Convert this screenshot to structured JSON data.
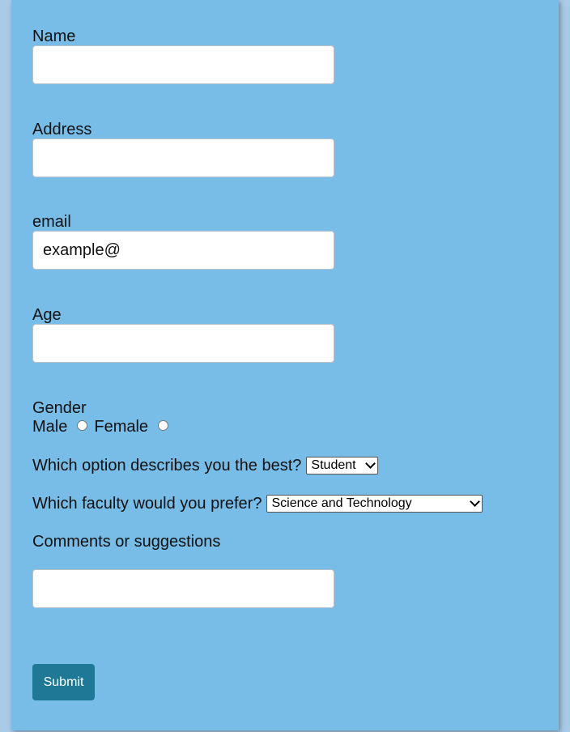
{
  "form": {
    "name": {
      "label": "Name",
      "value": ""
    },
    "address": {
      "label": "Address",
      "value": ""
    },
    "email": {
      "label": "email",
      "placeholder": "example@"
    },
    "age": {
      "label": "Age",
      "value": ""
    },
    "gender": {
      "label": "Gender",
      "options": [
        "Male",
        "Female"
      ]
    },
    "occupation": {
      "question": "Which option describes you the best?",
      "selected": "Student"
    },
    "faculty": {
      "question": "Which faculty would you prefer?",
      "selected": "Science and Technology"
    },
    "comments": {
      "label": "Comments or suggestions",
      "value": ""
    },
    "submit_label": "Submit"
  },
  "colors": {
    "page_background": "#a9cbe8",
    "card_background": "#77bde8",
    "submit_button": "#1e7896"
  }
}
